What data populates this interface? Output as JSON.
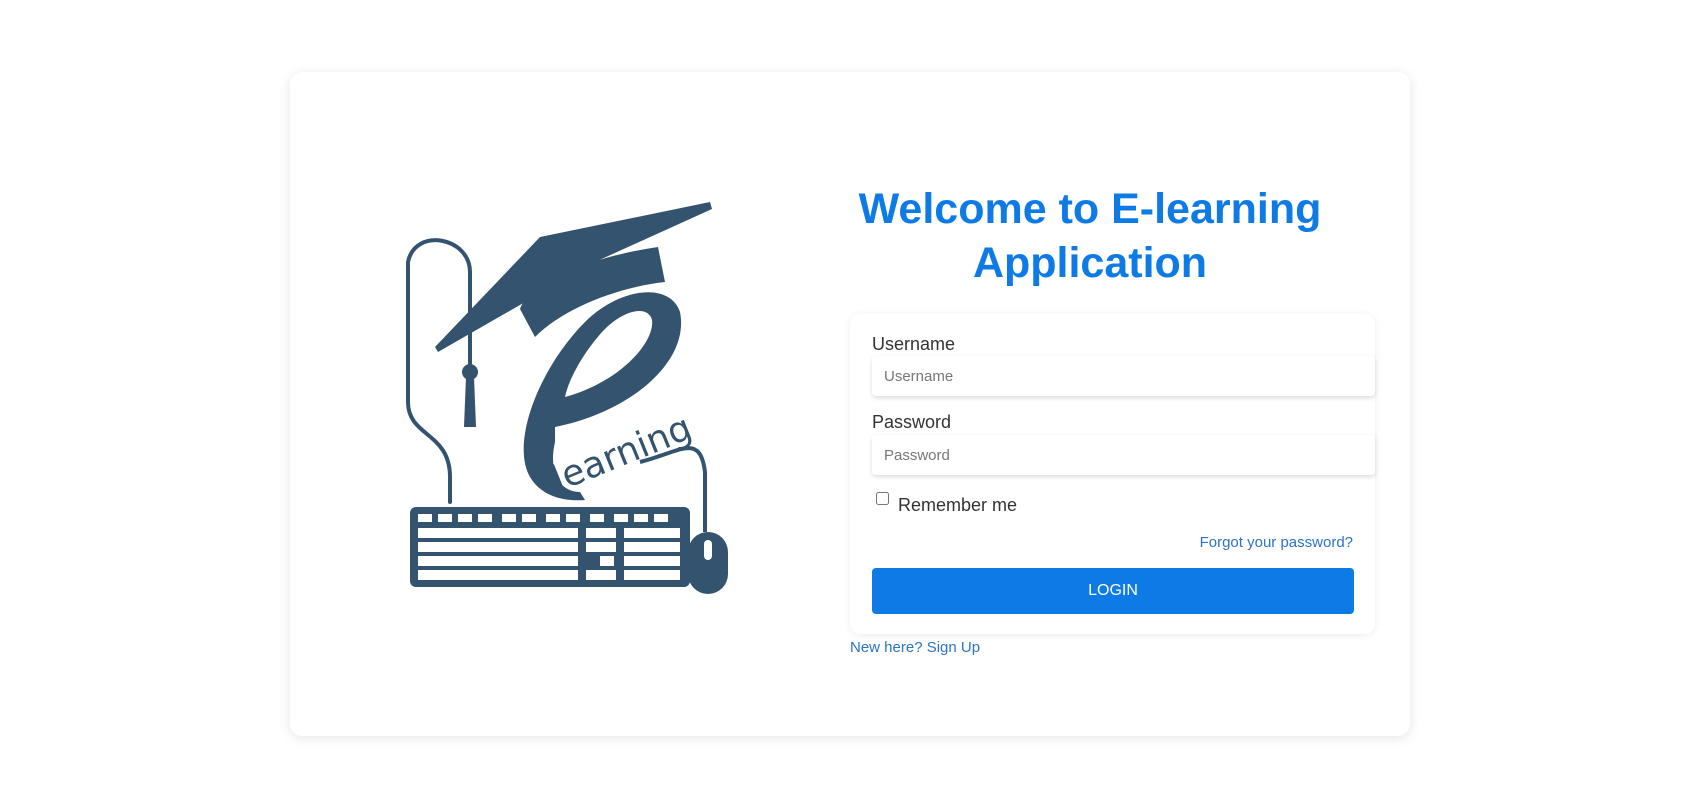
{
  "page": {
    "title": "Welcome to E-learning Application",
    "accent_color": "#0d7ae6"
  },
  "logo": {
    "icon": "elearning-logo",
    "text": "learning",
    "color": "#34536f"
  },
  "form": {
    "username_label": "Username",
    "username_placeholder": "Username",
    "username_value": "",
    "password_label": "Password",
    "password_placeholder": "Password",
    "password_value": "",
    "remember_label": "Remember me",
    "remember_checked": false,
    "forgot_link": "Forgot your password?",
    "login_button": "LOGIN"
  },
  "signup_link": "New here? Sign Up"
}
